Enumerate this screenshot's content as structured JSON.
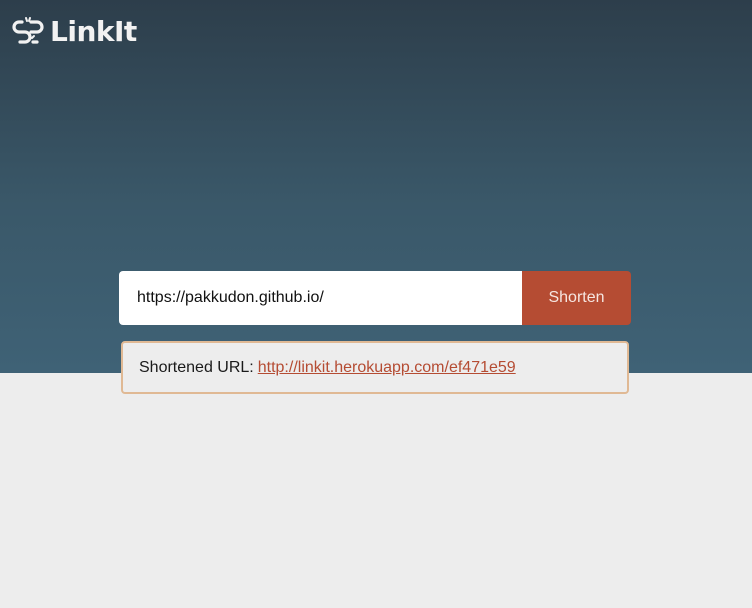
{
  "brand": {
    "name": "LinkIt",
    "icon": "broken-link-icon"
  },
  "form": {
    "url_value": "https://pakkudon.github.io/",
    "shorten_label": "Shorten"
  },
  "result": {
    "label": "Shortened URL:",
    "link": "http://linkit.herokuapp.com/ef471e59"
  },
  "colors": {
    "hero_top": "#2d3e4b",
    "hero_bottom": "#3f6276",
    "accent": "#b54c33",
    "result_border": "#e0b994",
    "page_bg": "#ededed"
  }
}
